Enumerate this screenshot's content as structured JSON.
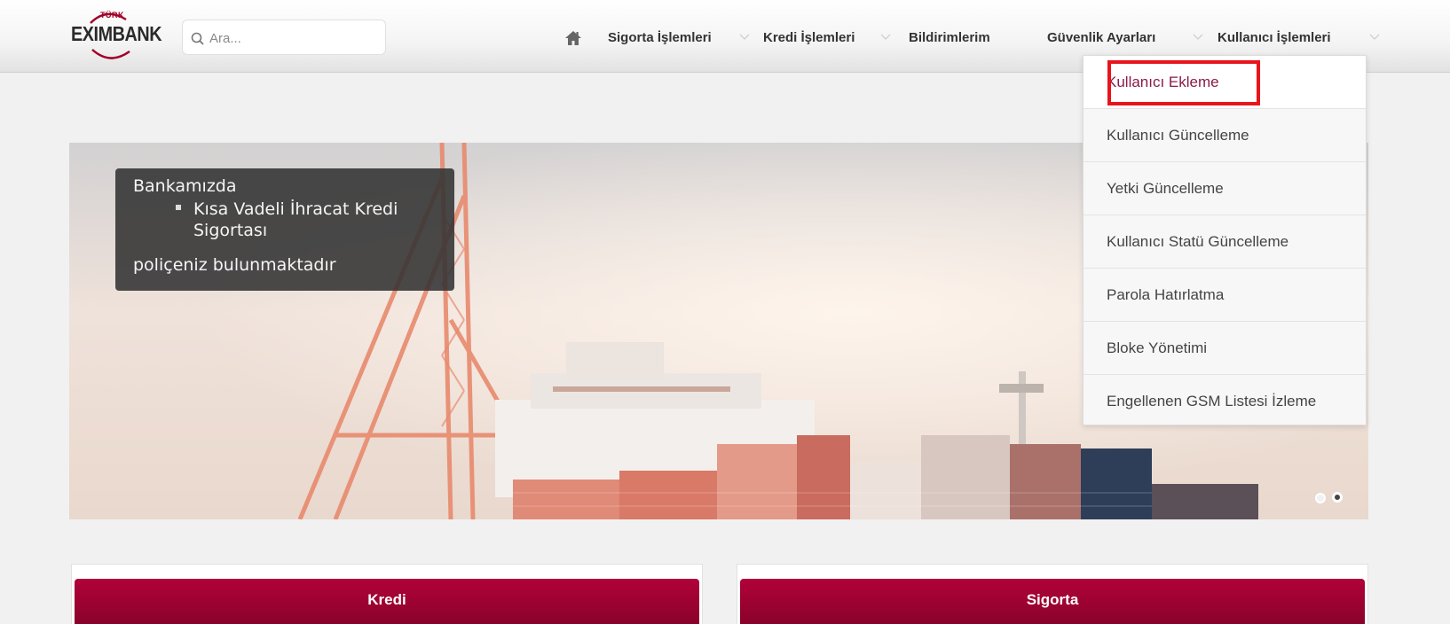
{
  "brand": {
    "logo_top": "TÜRK",
    "logo_main": "EXIMBANK"
  },
  "search": {
    "placeholder": "Ara..."
  },
  "nav": {
    "items": [
      {
        "label": "Sigorta İşlemleri",
        "has_menu": true
      },
      {
        "label": "Kredi İşlemleri",
        "has_menu": true
      },
      {
        "label": "Bildirimlerim",
        "has_menu": false
      },
      {
        "label": "Güvenlik Ayarları",
        "has_menu": true
      },
      {
        "label": "Kullanıcı İşlemleri",
        "has_menu": true
      }
    ]
  },
  "dropdown": {
    "items": [
      {
        "label": "Kullanıcı Ekleme",
        "highlighted": true
      },
      {
        "label": "Kullanıcı Güncelleme"
      },
      {
        "label": "Yetki Güncelleme"
      },
      {
        "label": "Kullanıcı Statü Güncelleme"
      },
      {
        "label": "Parola Hatırlatma"
      },
      {
        "label": "Bloke Yönetimi"
      },
      {
        "label": "Engellenen GSM Listesi İzleme"
      }
    ]
  },
  "slider": {
    "caption": {
      "line1": "Bankamızda",
      "bullet_part1": "Kısa Vadeli İhracat Kredi",
      "bullet_part2": "Sigortası",
      "line3": "poliçeniz bulunmaktadır"
    },
    "slide_count": 2,
    "active_slide_index": 1
  },
  "panels": [
    {
      "label": "Kredi"
    },
    {
      "label": "Sigorta"
    }
  ],
  "colors": {
    "accent": "#9a0230",
    "highlight_border": "#e8141c",
    "menu_active_text": "#8b1a4a"
  }
}
